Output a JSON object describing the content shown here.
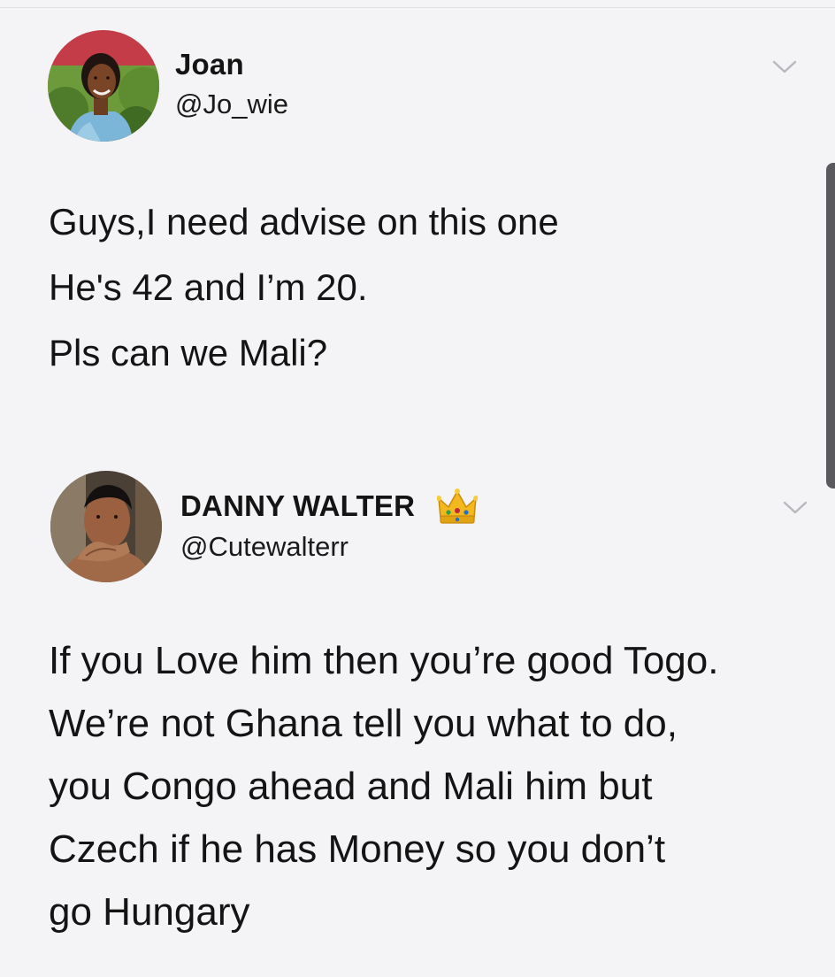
{
  "tweets": [
    {
      "display_name": "Joan",
      "handle": "@Jo_wie",
      "lines": [
        "Guys,I need advise on this one",
        "He's 42 and I’m 20.",
        "Pls can we Mali?"
      ],
      "avatar_icon": "profile-photo",
      "menu_icon": "chevron-down-icon"
    },
    {
      "display_name": "DANNY WALTER",
      "badge_icon": "crown-emoji",
      "handle": "@Cutewalterr",
      "lines": [
        "If you Love him then you’re good Togo.",
        "We’re not Ghana tell you what to do,",
        "you Congo ahead and Mali him but",
        "Czech if he has Money so you don’t",
        "go Hungary"
      ],
      "avatar_icon": "profile-photo",
      "menu_icon": "chevron-down-icon"
    }
  ],
  "colors": {
    "background": "#f4f4f6",
    "text": "#141414",
    "chevron": "#b8b8be",
    "scrollbar": "#5a5a5e"
  }
}
